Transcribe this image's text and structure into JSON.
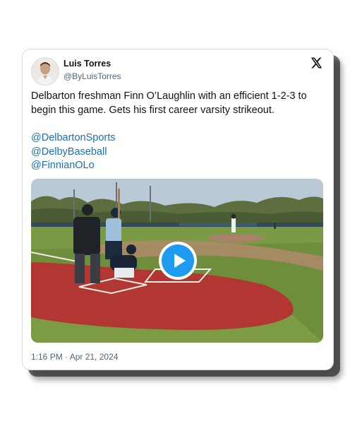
{
  "author": {
    "name": "Luis Torres",
    "handle": "@ByLuisTorres"
  },
  "icons": {
    "platform": "x-logo-icon",
    "play": "play-icon"
  },
  "tweet": {
    "text": "Delbarton freshman Finn O’Laughlin with an efficient 1-2-3 to begin this game. Gets his first career varsity strikeout.",
    "mentions": [
      "@DelbartonSports",
      "@DelbyBaseball",
      "@FinnianOLo"
    ],
    "timestamp": "1:16 PM · Apr 21, 2024"
  },
  "colors": {
    "link": "#1d6fb8",
    "play_button": "#1d9bf0",
    "muted_text": "#536471"
  }
}
